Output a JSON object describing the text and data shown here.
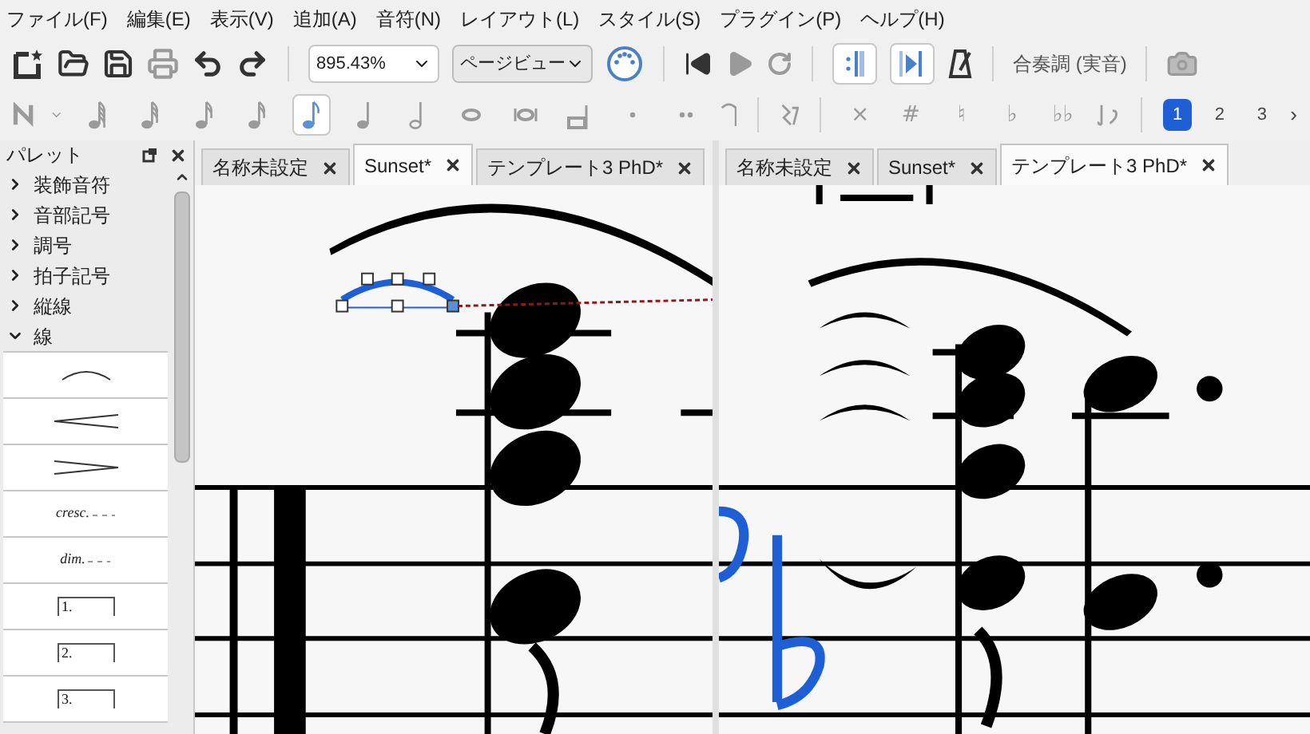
{
  "menu": [
    "ファイル(F)",
    "編集(E)",
    "表示(V)",
    "追加(A)",
    "音符(N)",
    "レイアウト(L)",
    "スタイル(S)",
    "プラグイン(P)",
    "ヘルプ(H)"
  ],
  "toolbar": {
    "zoom": "895.43%",
    "view": "ページビュー",
    "toggles": [
      {
        "kind": "loop-in",
        "on": true
      },
      {
        "kind": "loop-out",
        "on": true
      }
    ],
    "concert_pitch": "合奏調 (実音)"
  },
  "note_input": {
    "durations": [
      {
        "kind": "sixtyfourth",
        "selected": false
      },
      {
        "kind": "thirtysecond",
        "selected": false
      },
      {
        "kind": "sixteenth",
        "selected": false
      },
      {
        "kind": "sixteenthalt",
        "selected": false
      },
      {
        "kind": "eighth",
        "selected": true
      },
      {
        "kind": "quarter",
        "selected": false
      },
      {
        "kind": "half",
        "selected": false
      },
      {
        "kind": "whole",
        "selected": false
      },
      {
        "kind": "breve",
        "selected": false
      },
      {
        "kind": "longa",
        "selected": false
      },
      {
        "kind": "dot",
        "selected": false
      },
      {
        "kind": "double-dot",
        "selected": false
      }
    ],
    "accidentals": [
      "×",
      "#",
      "♮",
      "♭",
      "♭♭"
    ],
    "voices": [
      {
        "label": "1",
        "selected": true
      },
      {
        "label": "2",
        "selected": false
      },
      {
        "label": "3",
        "selected": false
      }
    ],
    "more": "›"
  },
  "palette": {
    "title": "パレット",
    "sections": [
      {
        "label": "装飾音符",
        "expanded": false
      },
      {
        "label": "音部記号",
        "expanded": false
      },
      {
        "label": "調号",
        "expanded": false
      },
      {
        "label": "拍子記号",
        "expanded": false
      },
      {
        "label": "縦線",
        "expanded": false
      },
      {
        "label": "線",
        "expanded": true
      }
    ],
    "cells": [
      {
        "kind": "slur"
      },
      {
        "kind": "cresc-hairpin"
      },
      {
        "kind": "dim-hairpin"
      },
      {
        "kind": "text-line",
        "label": "cresc."
      },
      {
        "kind": "text-line",
        "label": "dim."
      },
      {
        "kind": "volta",
        "label": "1."
      },
      {
        "kind": "volta",
        "label": "2."
      },
      {
        "kind": "volta",
        "label": "3."
      }
    ]
  },
  "panes": [
    {
      "kind": "sunset",
      "tabs": [
        {
          "label": "名称未設定",
          "selected": false
        },
        {
          "label": "Sunset*",
          "selected": true
        },
        {
          "label": "テンプレート3 PhD*",
          "selected": false
        }
      ]
    },
    {
      "kind": "template",
      "tabs": [
        {
          "label": "名称未設定",
          "selected": false
        },
        {
          "label": "Sunset*",
          "selected": false
        },
        {
          "label": "テンプレート3 PhD*",
          "selected": true
        }
      ]
    }
  ]
}
